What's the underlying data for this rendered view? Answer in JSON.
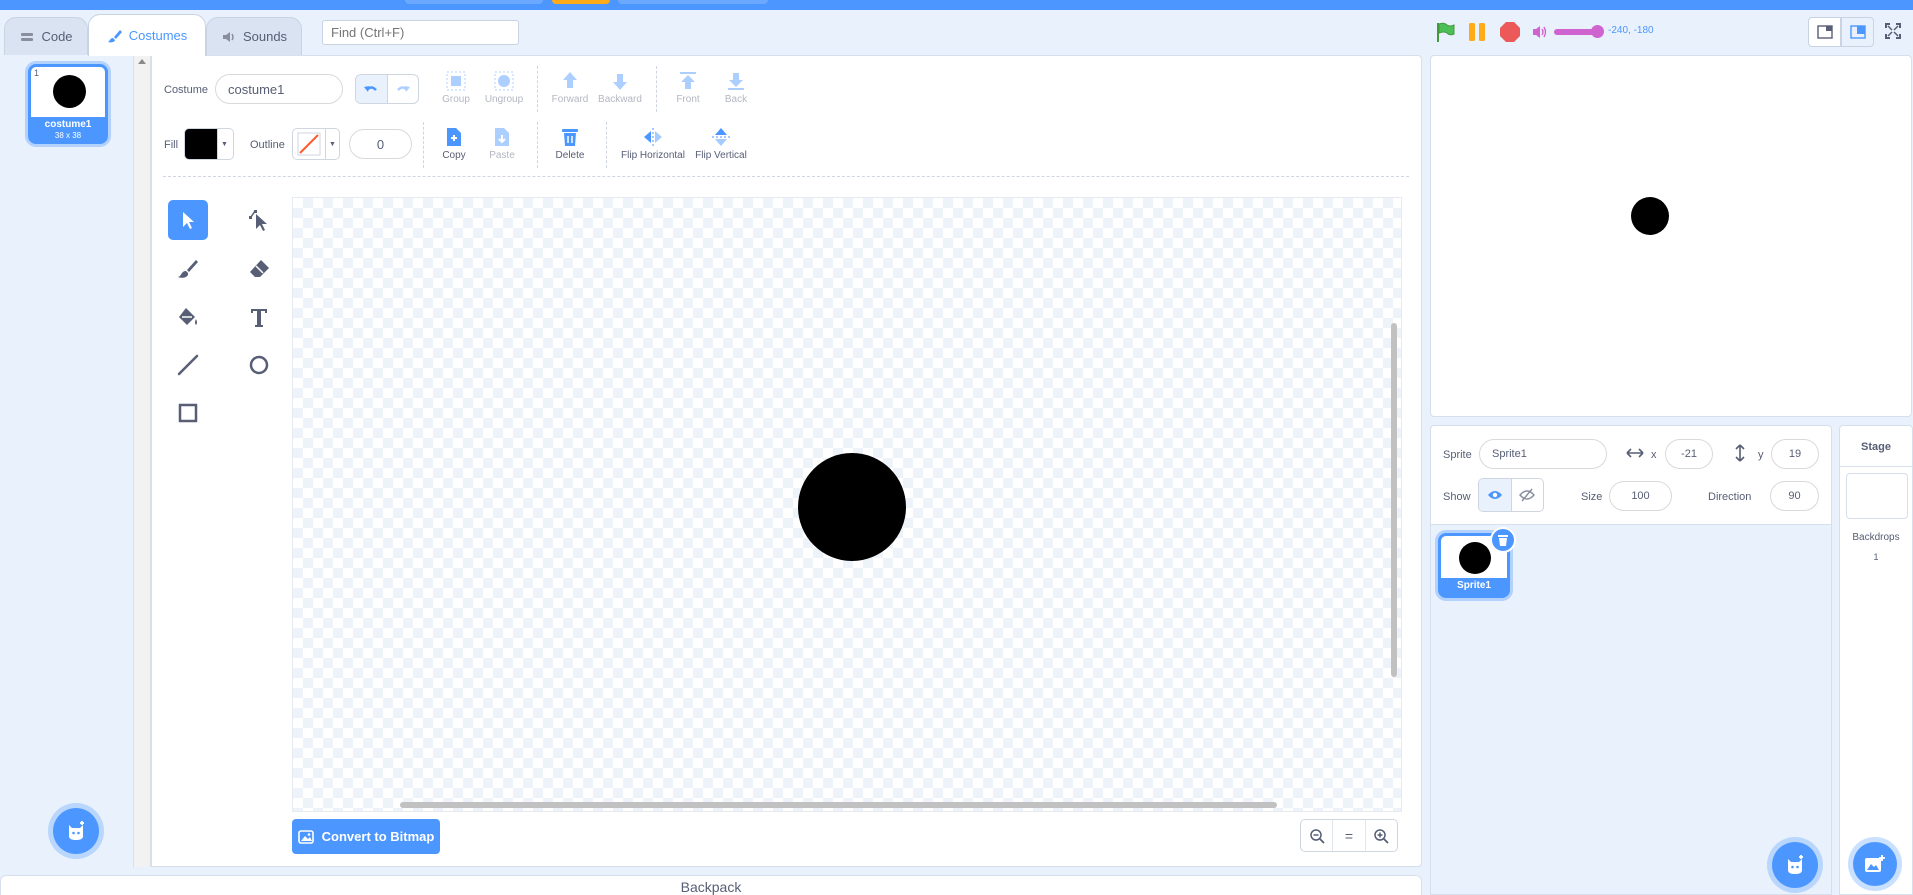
{
  "tabs": [
    {
      "label": "Code"
    },
    {
      "label": "Costumes"
    },
    {
      "label": "Sounds"
    }
  ],
  "search": {
    "placeholder": "Find (Ctrl+F)"
  },
  "costume_list": {
    "items": [
      {
        "number": "1",
        "name": "costume1",
        "size": "38 x 38"
      }
    ]
  },
  "editor": {
    "costume_label": "Costume",
    "costume_name": "costume1",
    "fill_label": "Fill",
    "outline_label": "Outline",
    "outline_width": "0",
    "fill_color": "#000000",
    "buttons": {
      "group": "Group",
      "ungroup": "Ungroup",
      "forward": "Forward",
      "backward": "Backward",
      "front": "Front",
      "back": "Back",
      "copy": "Copy",
      "paste": "Paste",
      "delete": "Delete",
      "flip_h": "Flip Horizontal",
      "flip_v": "Flip Vertical"
    },
    "convert_label": "Convert to Bitmap",
    "zoom": {
      "out": "−",
      "reset": "=",
      "in": "+"
    }
  },
  "backpack": {
    "label": "Backpack"
  },
  "stage_header": {
    "coords": "-240, -180"
  },
  "sprite_info": {
    "sprite_label": "Sprite",
    "sprite_name": "Sprite1",
    "x_label": "x",
    "x_value": "-21",
    "y_label": "y",
    "y_value": "19",
    "show_label": "Show",
    "size_label": "Size",
    "size_value": "100",
    "direction_label": "Direction",
    "direction_value": "90"
  },
  "sprites": [
    {
      "name": "Sprite1"
    }
  ],
  "stage_panel": {
    "title": "Stage",
    "backdrops_label": "Backdrops",
    "backdrops_count": "1"
  },
  "colors": {
    "accent": "#4c97ff",
    "sound": "#cf63cf",
    "go": "#4cbf56",
    "pause": "#ffab19",
    "stop": "#ec5959"
  }
}
